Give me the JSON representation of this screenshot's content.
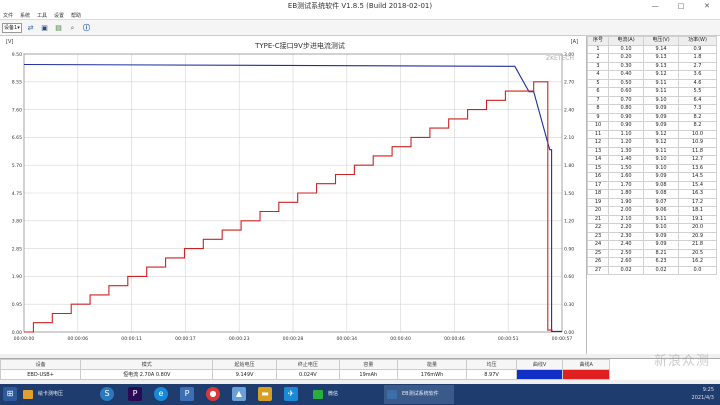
{
  "window": {
    "title": "EB测试系统软件 V1.8.5 (Build 2018-02-01)",
    "minimize": "—",
    "maximize": "□",
    "close": "✕"
  },
  "menu": [
    "文件",
    "系统",
    "工具",
    "设置",
    "帮助"
  ],
  "toolbar": {
    "device": "设备1",
    "icons": [
      "connect-icon",
      "save-icon",
      "print-icon",
      "zoom-icon",
      "info-icon"
    ]
  },
  "chart_data": {
    "type": "line",
    "title": "TYPE-C接口9V步进电流测试",
    "watermark": "ZKETECH",
    "left_unit": "[V]",
    "right_unit": "[A]",
    "y_left_ticks": [
      "9.50",
      "8.55",
      "7.60",
      "6.65",
      "5.70",
      "4.75",
      "3.80",
      "2.85",
      "1.90",
      "0.95",
      "0.00"
    ],
    "y_right_ticks": [
      "3.00",
      "2.70",
      "2.40",
      "2.10",
      "1.80",
      "1.50",
      "1.20",
      "0.90",
      "0.60",
      "0.30",
      "0.00"
    ],
    "x_ticks": [
      "00:00:00",
      "00:00:06",
      "00:00:11",
      "00:00:17",
      "00:00:23",
      "00:00:28",
      "00:00:34",
      "00:00:40",
      "00:00:46",
      "00:00:51",
      "00:00:57"
    ],
    "ylim_left": [
      0,
      9.5
    ],
    "ylim_right": [
      0,
      3.0
    ],
    "xlim_seconds": [
      0,
      57
    ],
    "series": [
      {
        "axis": "left",
        "color": "#1f2f9e",
        "x": [
          0,
          51.3,
          52.0,
          53.5,
          54.0,
          55.7,
          55.9,
          55.9,
          57.0
        ],
        "y": [
          9.14,
          9.08,
          9.08,
          8.21,
          8.21,
          6.23,
          6.23,
          0.02,
          0.02
        ]
      },
      {
        "axis": "right",
        "color": "#cc2222",
        "x": [
          0,
          1.0,
          1.0,
          3.0,
          3.0,
          5.0,
          5.0,
          7.0,
          7.0,
          9.0,
          9.0,
          11.0,
          11.0,
          13.0,
          13.0,
          15.0,
          15.0,
          17.0,
          17.0,
          19.0,
          19.0,
          21.0,
          21.0,
          23.0,
          23.0,
          25.0,
          25.0,
          27.0,
          27.0,
          29.0,
          29.0,
          31.0,
          31.0,
          33.0,
          33.0,
          35.0,
          35.0,
          37.0,
          37.0,
          39.0,
          39.0,
          41.0,
          41.0,
          43.0,
          43.0,
          45.0,
          45.0,
          47.0,
          47.0,
          49.0,
          49.0,
          51.0,
          51.0,
          54.0,
          54.0,
          55.5,
          55.5,
          56.0
        ],
        "y": [
          0.0,
          0.0,
          0.1,
          0.1,
          0.2,
          0.2,
          0.3,
          0.3,
          0.4,
          0.4,
          0.5,
          0.5,
          0.6,
          0.6,
          0.7,
          0.7,
          0.8,
          0.8,
          0.9,
          0.9,
          1.0,
          1.0,
          1.1,
          1.1,
          1.2,
          1.2,
          1.3,
          1.3,
          1.4,
          1.4,
          1.5,
          1.5,
          1.6,
          1.6,
          1.7,
          1.7,
          1.8,
          1.8,
          1.9,
          1.9,
          2.0,
          2.0,
          2.1,
          2.1,
          2.2,
          2.2,
          2.3,
          2.3,
          2.4,
          2.4,
          2.5,
          2.5,
          2.6,
          2.6,
          2.7,
          2.7,
          0.02,
          0.02
        ]
      }
    ]
  },
  "table": {
    "headers": [
      "序号",
      "电流(A)",
      "电压(V)",
      "功率(W)"
    ],
    "rows": [
      [
        "1",
        "0.10",
        "9.14",
        "0.9"
      ],
      [
        "2",
        "0.20",
        "9.13",
        "1.8"
      ],
      [
        "3",
        "0.30",
        "9.13",
        "2.7"
      ],
      [
        "4",
        "0.40",
        "9.12",
        "3.6"
      ],
      [
        "5",
        "0.50",
        "9.11",
        "4.6"
      ],
      [
        "6",
        "0.60",
        "9.11",
        "5.5"
      ],
      [
        "7",
        "0.70",
        "9.10",
        "6.4"
      ],
      [
        "8",
        "0.80",
        "9.09",
        "7.3"
      ],
      [
        "9",
        "0.90",
        "9.09",
        "8.2"
      ],
      [
        "10",
        "0.90",
        "9.09",
        "8.2"
      ],
      [
        "11",
        "1.10",
        "9.12",
        "10.0"
      ],
      [
        "12",
        "1.20",
        "9.12",
        "10.9"
      ],
      [
        "13",
        "1.30",
        "9.11",
        "11.8"
      ],
      [
        "14",
        "1.40",
        "9.10",
        "12.7"
      ],
      [
        "15",
        "1.50",
        "9.10",
        "13.6"
      ],
      [
        "16",
        "1.60",
        "9.09",
        "14.5"
      ],
      [
        "17",
        "1.70",
        "9.08",
        "15.4"
      ],
      [
        "18",
        "1.80",
        "9.08",
        "16.3"
      ],
      [
        "19",
        "1.90",
        "9.07",
        "17.2"
      ],
      [
        "20",
        "2.00",
        "9.06",
        "18.1"
      ],
      [
        "21",
        "2.10",
        "9.11",
        "19.1"
      ],
      [
        "22",
        "2.20",
        "9.10",
        "20.0"
      ],
      [
        "23",
        "2.30",
        "9.09",
        "20.9"
      ],
      [
        "24",
        "2.40",
        "9.09",
        "21.8"
      ],
      [
        "25",
        "2.50",
        "8.21",
        "20.5"
      ],
      [
        "26",
        "2.60",
        "6.23",
        "16.2"
      ],
      [
        "27",
        "0.02",
        "0.02",
        "0.0"
      ]
    ]
  },
  "summary": {
    "headers": [
      "设备",
      "模式",
      "起始电压",
      "终止电压",
      "容量",
      "能量",
      "均压",
      "曲线V",
      "曲线A"
    ],
    "values": [
      "EBD-USB+",
      "恒电流  2.70A  0.80V",
      "9.149V",
      "0.024V",
      "19mAh",
      "176mWh",
      "8.97V",
      "",
      ""
    ],
    "colors": {
      "curve_v": "#1030c8",
      "curve_a": "#e02020"
    }
  },
  "taskbar": {
    "items": [
      {
        "label": "绘卡测电压",
        "color": "#e0a030",
        "icon": "folder-icon"
      },
      {
        "label": "EB测试系统软件",
        "color": "#3c6ea8",
        "icon": "app-icon"
      },
      {
        "label": "微信",
        "color": "#2aae3c",
        "icon": "wechat-icon"
      }
    ],
    "clock_time": "9:25",
    "clock_date": "2021/4/3"
  },
  "watermark": "新浪众测"
}
